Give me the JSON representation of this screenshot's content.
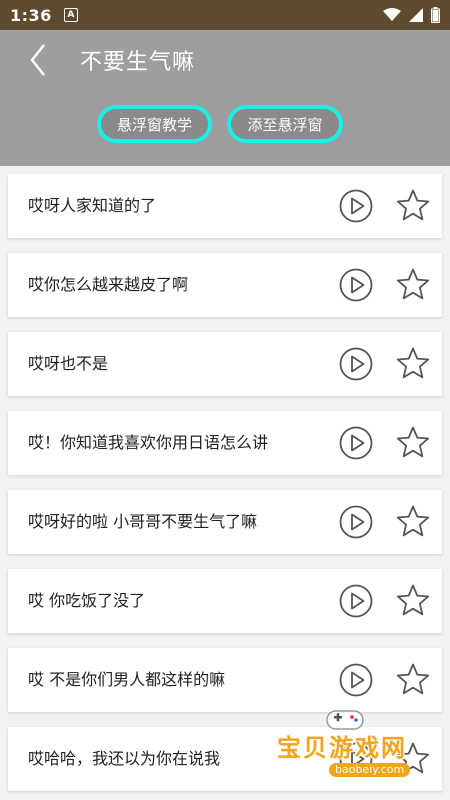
{
  "status_bar": {
    "time": "1:36",
    "notification_glyph": "A"
  },
  "header": {
    "title": "不要生气嘛",
    "buttons": [
      {
        "label": "悬浮窗教学"
      },
      {
        "label": "添至悬浮窗"
      }
    ]
  },
  "items": [
    {
      "text": "哎呀人家知道的了"
    },
    {
      "text": "哎你怎么越来越皮了啊"
    },
    {
      "text": "哎呀也不是"
    },
    {
      "text": "哎！你知道我喜欢你用日语怎么讲"
    },
    {
      "text": "哎呀好的啦 小哥哥不要生气了嘛"
    },
    {
      "text": "哎 你吃饭了没了"
    },
    {
      "text": "哎 不是你们男人都这样的嘛"
    },
    {
      "text": "哎哈哈，我还以为你在说我"
    }
  ],
  "watermark": {
    "text": "宝贝游戏网",
    "url": "baobeiy.com"
  },
  "colors": {
    "status_bar": "#5e4a2e",
    "header": "#9e9e9e",
    "pill_border": "#18f0e8",
    "watermark": "#f2a51a"
  }
}
